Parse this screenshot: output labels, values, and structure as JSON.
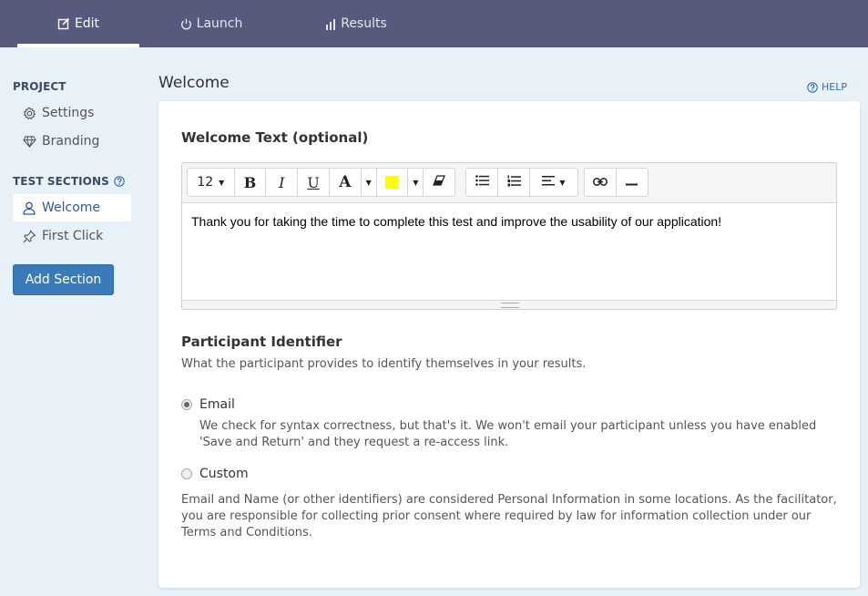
{
  "nav": {
    "tabs": [
      {
        "label": "Edit",
        "icon": "edit-icon",
        "active": true
      },
      {
        "label": "Launch",
        "icon": "power-icon",
        "active": false
      },
      {
        "label": "Results",
        "icon": "bar-chart-icon",
        "active": false
      }
    ]
  },
  "sidebar": {
    "project_heading": "PROJECT",
    "project_items": [
      {
        "label": "Settings",
        "icon": "gear-icon"
      },
      {
        "label": "Branding",
        "icon": "diamond-icon"
      }
    ],
    "sections_heading": "TEST SECTIONS",
    "section_items": [
      {
        "label": "Welcome",
        "icon": "user-icon",
        "active": true
      },
      {
        "label": "First Click",
        "icon": "pin-icon",
        "active": false
      }
    ],
    "add_button": "Add Section"
  },
  "main": {
    "title": "Welcome",
    "help_label": "HELP",
    "welcome_text": {
      "heading": "Welcome Text (optional)",
      "font_size": "12",
      "highlight_color": "#ffff00",
      "content": "Thank you for taking the time to complete this test and improve the usability of our application!"
    },
    "participant": {
      "heading": "Participant Identifier",
      "description": "What the participant provides to identify themselves in your results.",
      "options": [
        {
          "label": "Email",
          "checked": true,
          "description": "We check for syntax correctness, but that's it. We won't email your participant unless you have enabled 'Save and Return' and they request a re-access link."
        },
        {
          "label": "Custom",
          "checked": false
        }
      ],
      "note": "Email and Name (or other identifiers) are considered Personal Information in some locations. As the facilitator, you are responsible for collecting prior consent where required by law for information collection under our Terms and Conditions."
    }
  },
  "colors": {
    "nav_bg": "#575a7c",
    "page_bg": "#e8f1f7",
    "accent": "#3a7ab8",
    "link": "#2b6cb0"
  }
}
